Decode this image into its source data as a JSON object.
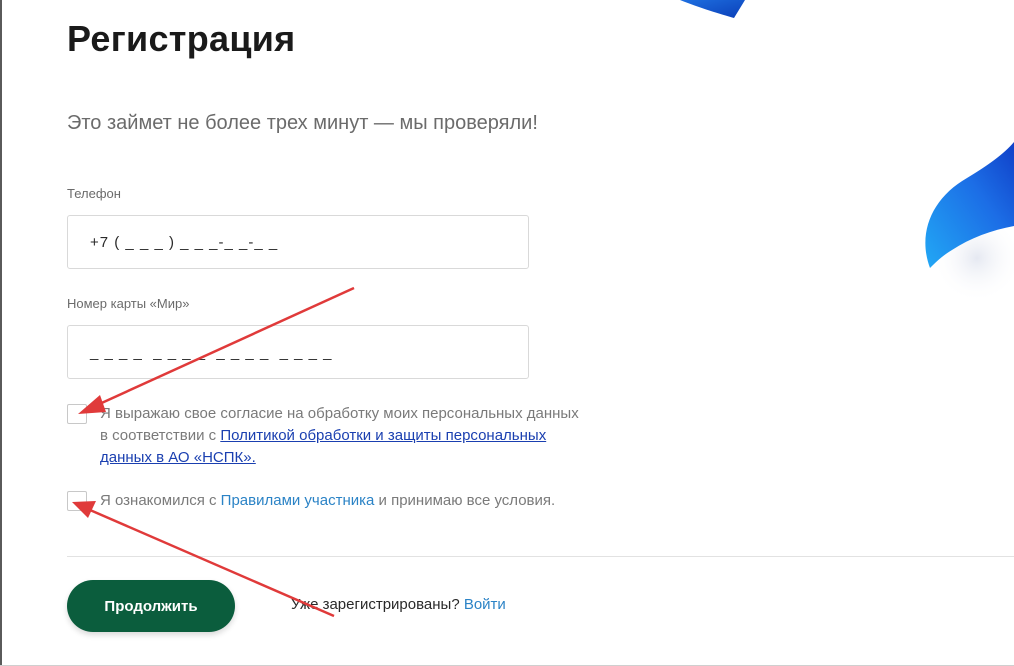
{
  "header": {
    "title": "Регистрация",
    "subtitle": "Это займет не более трех минут — мы проверяли!"
  },
  "phone": {
    "label": "Телефон",
    "mask": "+7 ( _ _ _ ) _ _ _-_ _-_ _"
  },
  "card": {
    "label": "Номер карты «Мир»",
    "mask": "_ _ _ _  _ _ _ _  _ _ _ _  _ _ _ _"
  },
  "consent": {
    "text_before": "Я выражаю свое согласие на обработку моих персональных данных в соответствии с ",
    "link": "Политикой обработки и защиты персональных данных в АО «НСПК».",
    "checked": false
  },
  "rules": {
    "text_before": "Я ознакомился с ",
    "link": "Правилами участника",
    "text_after": " и принимаю все условия.",
    "checked": false
  },
  "footer": {
    "continue_label": "Продолжить",
    "already_text": "Уже зарегистрированы?",
    "login_link": "Войти"
  },
  "colors": {
    "primary_button": "#0b5d3d",
    "link": "#2b83c6",
    "annotation_arrow": "#e03a3a",
    "decor_blue": "#1e74e8"
  },
  "icons": [
    "annotation-arrow-icon",
    "decor-ribbon-icon"
  ]
}
